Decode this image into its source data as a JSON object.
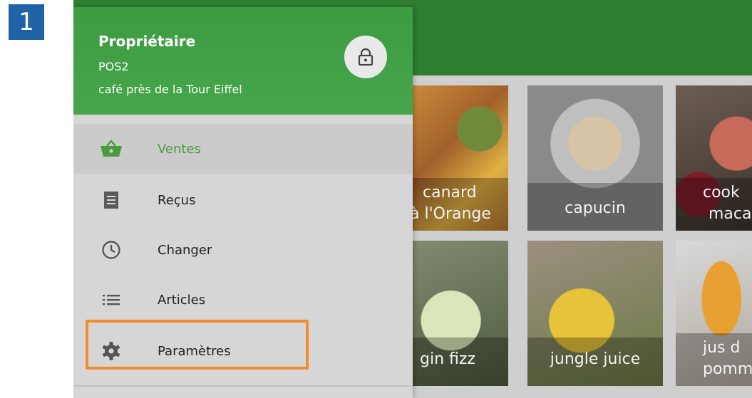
{
  "step": {
    "number": "1"
  },
  "drawer": {
    "header": {
      "owner": "Propriétaire",
      "device": "POS2",
      "store": "café près de la Tour Eiffel",
      "lock_icon": "lock-icon"
    },
    "items": [
      {
        "label": "Ventes",
        "icon": "basket-icon",
        "active": true
      },
      {
        "label": "Reçus",
        "icon": "receipt-icon",
        "active": false
      },
      {
        "label": "Changer",
        "icon": "clock-icon",
        "active": false
      },
      {
        "label": "Articles",
        "icon": "list-icon",
        "active": false
      },
      {
        "label": "Paramètres",
        "icon": "gear-icon",
        "active": false,
        "highlighted": true
      }
    ]
  },
  "products": [
    {
      "line1": "canard",
      "line2": "à l'Orange"
    },
    {
      "line1": "capucin",
      "line2": ""
    },
    {
      "line1": "cook",
      "line2": "macar"
    },
    {
      "line1": "gin fizz",
      "line2": ""
    },
    {
      "line1": "jungle juice",
      "line2": ""
    },
    {
      "line1": "jus d",
      "line2": "pomm"
    }
  ],
  "colors": {
    "accent_green": "#43a047",
    "appbar_green": "#2f7d31",
    "highlight_orange": "#f28a2e",
    "step_badge_blue": "#1f63a6"
  }
}
